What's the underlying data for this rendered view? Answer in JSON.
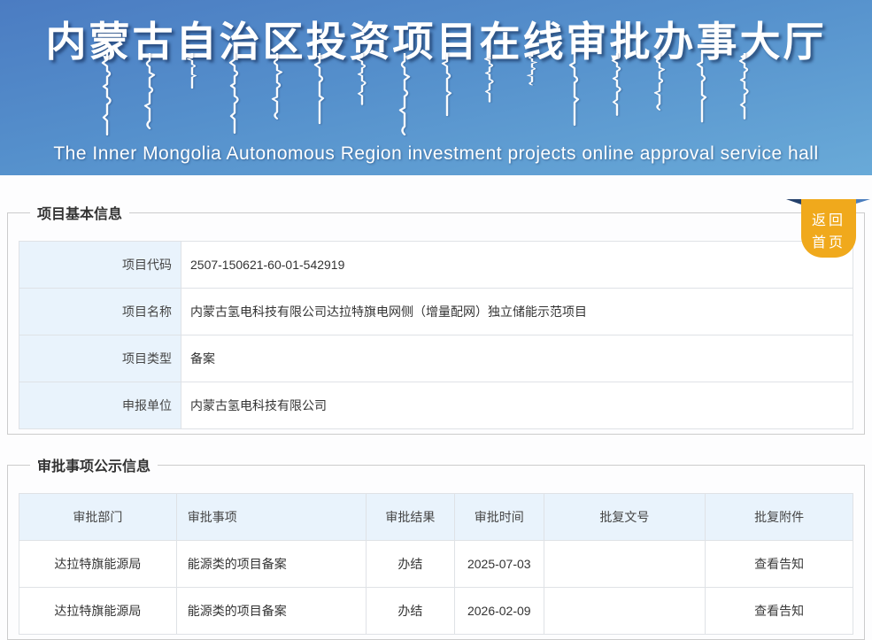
{
  "header": {
    "title_zh": "内蒙古自治区投资项目在线审批办事大厅",
    "subtitle_en": "The Inner Mongolia Autonomous Region investment projects online approval service hall"
  },
  "back_button": {
    "line1": "返回",
    "line2": "首页"
  },
  "basic_info": {
    "legend": "项目基本信息",
    "rows": [
      {
        "label": "项目代码",
        "value": "2507-150621-60-01-542919"
      },
      {
        "label": "项目名称",
        "value": "内蒙古氢电科技有限公司达拉特旗电网侧（增量配网）独立储能示范项目"
      },
      {
        "label": "项目类型",
        "value": "备案"
      },
      {
        "label": "申报单位",
        "value": "内蒙古氢电科技有限公司"
      }
    ]
  },
  "approval_info": {
    "legend": "审批事项公示信息",
    "columns": [
      "审批部门",
      "审批事项",
      "审批结果",
      "审批时间",
      "批复文号",
      "批复附件"
    ],
    "rows": [
      {
        "department": "达拉特旗能源局",
        "item": "能源类的项目备案",
        "result": "办结",
        "time": "2025-07-03",
        "doc_no": "",
        "attachment": "查看告知"
      },
      {
        "department": "达拉特旗能源局",
        "item": "能源类的项目备案",
        "result": "办结",
        "time": "2026-02-09",
        "doc_no": "",
        "attachment": "查看告知"
      }
    ]
  },
  "colors": {
    "banner_gradient_top": "#4b7cc2",
    "banner_gradient_bottom": "#69aad8",
    "back_button": "#f0a91c",
    "table_header_bg": "#e9f3fc",
    "table_border": "#dfe2e6",
    "text": "#333333"
  }
}
